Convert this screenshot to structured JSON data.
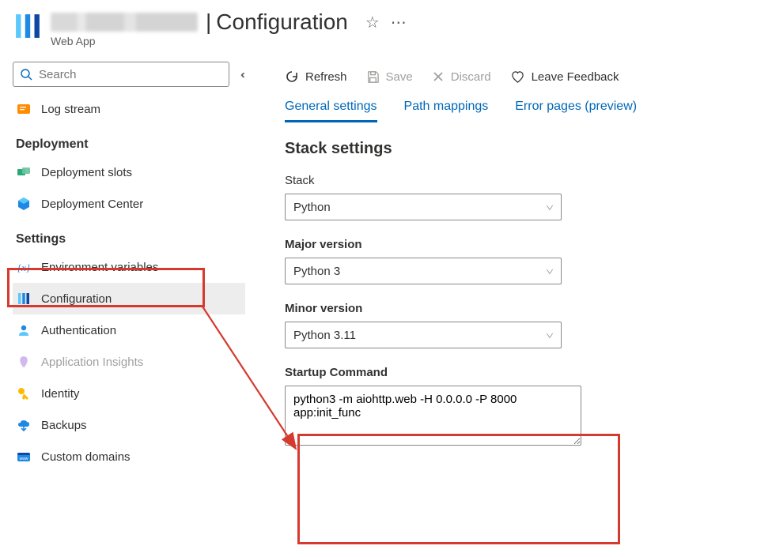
{
  "header": {
    "title_suffix": "Configuration",
    "subtitle": "Web App"
  },
  "sidebar": {
    "search_placeholder": "Search",
    "top_item": {
      "label": "Log stream"
    },
    "sections": [
      {
        "title": "Deployment",
        "items": [
          {
            "label": "Deployment slots"
          },
          {
            "label": "Deployment Center"
          }
        ]
      },
      {
        "title": "Settings",
        "items": [
          {
            "label": "Environment variables"
          },
          {
            "label": "Configuration",
            "selected": true
          },
          {
            "label": "Authentication"
          },
          {
            "label": "Application Insights",
            "disabled": true
          },
          {
            "label": "Identity"
          },
          {
            "label": "Backups"
          },
          {
            "label": "Custom domains"
          }
        ]
      }
    ]
  },
  "toolbar": {
    "refresh": "Refresh",
    "save": "Save",
    "discard": "Discard",
    "feedback": "Leave Feedback"
  },
  "tabs": {
    "general": "General settings",
    "path": "Path mappings",
    "errors": "Error pages (preview)"
  },
  "stack": {
    "section_title": "Stack settings",
    "stack_label": "Stack",
    "stack_value": "Python",
    "major_label": "Major version",
    "major_value": "Python 3",
    "minor_label": "Minor version",
    "minor_value": "Python 3.11",
    "startup_label": "Startup Command",
    "startup_value": "python3 -m aiohttp.web -H 0.0.0.0 -P 8000 app:init_func"
  }
}
